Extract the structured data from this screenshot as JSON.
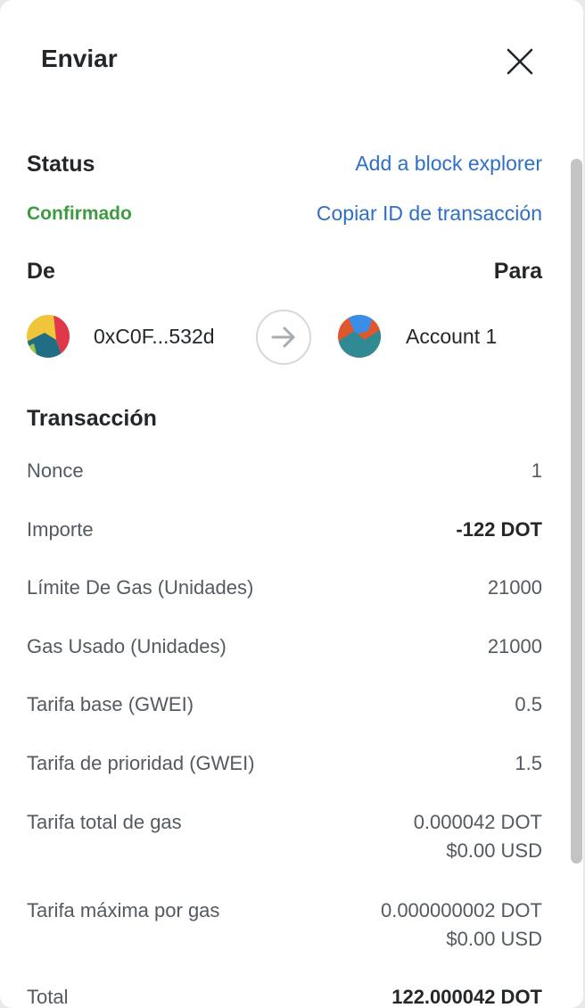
{
  "header": {
    "title": "Enviar"
  },
  "status": {
    "label": "Status",
    "value": "Confirmado",
    "add_explorer": "Add a block explorer",
    "copy_id": "Copiar ID de transacción"
  },
  "parties": {
    "from_label": "De",
    "to_label": "Para",
    "from_address": "0xC0F...532d",
    "to_name": "Account 1"
  },
  "transaction": {
    "title": "Transacción",
    "rows": [
      {
        "label": "Nonce",
        "value": "1"
      },
      {
        "label": "Importe",
        "value": "-122 DOT"
      },
      {
        "label": "Límite De Gas (Unidades)",
        "value": "21000"
      },
      {
        "label": "Gas Usado (Unidades)",
        "value": "21000"
      },
      {
        "label": "Tarifa base (GWEI)",
        "value": "0.5"
      },
      {
        "label": "Tarifa de prioridad (GWEI)",
        "value": "1.5"
      },
      {
        "label": "Tarifa total de gas",
        "value": "0.000042 DOT",
        "value2": "$0.00 USD"
      },
      {
        "label": "Tarifa máxima por gas",
        "value": "0.000000002 DOT",
        "value2": "$0.00 USD"
      },
      {
        "label": "Total",
        "value": "122.000042 DOT"
      }
    ]
  },
  "colors": {
    "accent_link": "#2f6fc7",
    "status_green": "#3e9b43"
  }
}
